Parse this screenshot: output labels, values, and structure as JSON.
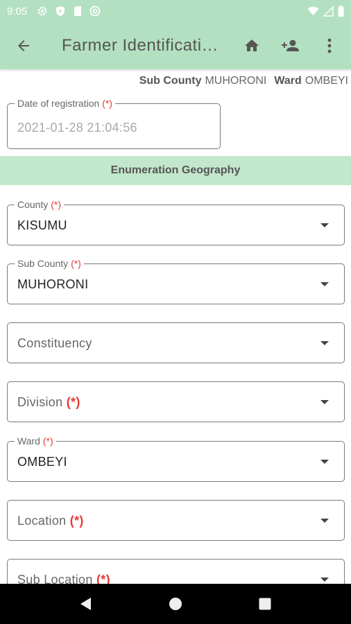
{
  "status_bar": {
    "time": "9:05",
    "left_icons": [
      "gear-icon",
      "shield-play-icon",
      "sd-card-icon",
      "at-sign-icon"
    ],
    "right_icons": [
      "wifi-icon",
      "cell-signal-icon",
      "battery-icon"
    ]
  },
  "app_bar": {
    "title": "Farmer Identificati…",
    "back_icon": "arrow-left-icon",
    "actions": [
      "home-icon",
      "add-person-icon",
      "more-vert-icon"
    ],
    "color": "#b3e0c0"
  },
  "info": {
    "sub_county_label": "Sub County",
    "sub_county_value": "MUHORONI",
    "ward_label": "Ward",
    "ward_value": "OMBEYI"
  },
  "date_field": {
    "label": "Date of registration",
    "required": "(*)",
    "value": "2021-01-28 21:04:56"
  },
  "section": {
    "title": "Enumeration Geography",
    "color": "#c3e7cc"
  },
  "fields": {
    "county": {
      "label": "County",
      "required": "(*)",
      "value": "KISUMU"
    },
    "sub_county": {
      "label": "Sub County",
      "required": "(*)",
      "value": "MUHORONI"
    },
    "constituency": {
      "placeholder": "Constituency"
    },
    "division": {
      "placeholder": "Division",
      "required": "(*)"
    },
    "ward": {
      "label": "Ward",
      "required": "(*)",
      "value": "OMBEYI"
    },
    "location": {
      "placeholder": "Location",
      "required": "(*)"
    },
    "sub_location": {
      "placeholder": "Sub Location",
      "required": "(*)"
    }
  },
  "nav_bar": {
    "buttons": [
      "back-triangle-icon",
      "home-circle-icon",
      "recents-square-icon"
    ]
  },
  "colors": {
    "required": "#e53935",
    "border": "#7a7a7a"
  }
}
